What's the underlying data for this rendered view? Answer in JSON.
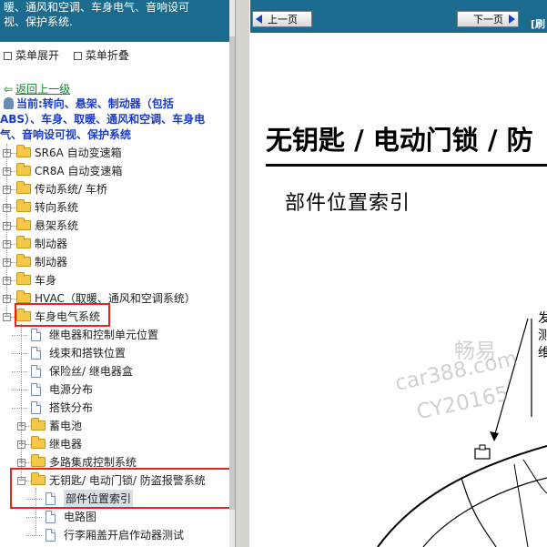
{
  "left_panel": {
    "header_lines": [
      "暖、通风和空调、车身电气、音响设可",
      "视、保护系统."
    ],
    "expand_all_label": "菜单展开",
    "collapse_all_label": "菜单折叠",
    "back_link": "返回上一级",
    "current_path": [
      "当前:转向、悬架、制动器（包括",
      "ABS）、车身、取暖、通风和空调、车身电",
      "气、音响设可视、保护系统"
    ],
    "tree": [
      {
        "label": "SR6A 自动变速箱",
        "type": "folder",
        "level": 0,
        "state": "collapsed"
      },
      {
        "label": "CR8A 自动变速箱",
        "type": "folder",
        "level": 0,
        "state": "collapsed"
      },
      {
        "label": "传动系统/ 车桥",
        "type": "folder",
        "level": 0,
        "state": "collapsed"
      },
      {
        "label": "转向系统",
        "type": "folder",
        "level": 0,
        "state": "collapsed"
      },
      {
        "label": "悬架系统",
        "type": "folder",
        "level": 0,
        "state": "collapsed"
      },
      {
        "label": "制动器",
        "type": "folder",
        "level": 0,
        "state": "collapsed"
      },
      {
        "label": "制动器",
        "type": "folder",
        "level": 0,
        "state": "collapsed"
      },
      {
        "label": "车身",
        "type": "folder",
        "level": 0,
        "state": "collapsed"
      },
      {
        "label": "HVAC（取暖、通风和空调系统）",
        "type": "folder",
        "level": 0,
        "state": "collapsed"
      },
      {
        "label": "车身电气系统",
        "type": "folder",
        "level": 0,
        "state": "expanded"
      },
      {
        "label": "继电器和控制单元位置",
        "type": "doc",
        "level": 1
      },
      {
        "label": "线束和搭铁位置",
        "type": "doc",
        "level": 1
      },
      {
        "label": "保险丝/ 继电器盒",
        "type": "doc",
        "level": 1
      },
      {
        "label": "电源分布",
        "type": "doc",
        "level": 1
      },
      {
        "label": "搭铁分布",
        "type": "doc",
        "level": 1
      },
      {
        "label": "蓄电池",
        "type": "folder",
        "level": 1,
        "state": "collapsed"
      },
      {
        "label": "继电器",
        "type": "folder",
        "level": 1,
        "state": "collapsed"
      },
      {
        "label": "多路集成控制系统",
        "type": "folder",
        "level": 1,
        "state": "collapsed"
      },
      {
        "label": "无钥匙/ 电动门锁/ 防盗报警系统",
        "type": "folder",
        "level": 1,
        "state": "expanded"
      },
      {
        "label": "部件位置索引",
        "type": "doc",
        "level": 2,
        "selected": true
      },
      {
        "label": "电路图",
        "type": "doc",
        "level": 2
      },
      {
        "label": "行李厢盖开启作动器测试",
        "type": "doc",
        "level": 2
      }
    ]
  },
  "right_panel": {
    "prev_label": "上一页",
    "next_label": "下一页",
    "nav_cut_text": "[刷",
    "title": "无钥匙 / 电动门锁 / 防",
    "subtitle": "部件位置索引",
    "callout_lines": [
      "发",
      "测",
      "维"
    ],
    "watermark": [
      "畅易",
      "car388.com",
      "CY20165"
    ]
  },
  "colors": {
    "header_bg": "#1b6b8f",
    "highlight_box": "#e0271f",
    "current_path_text": "#1a3cc8",
    "back_link": "#0a8a2a"
  }
}
